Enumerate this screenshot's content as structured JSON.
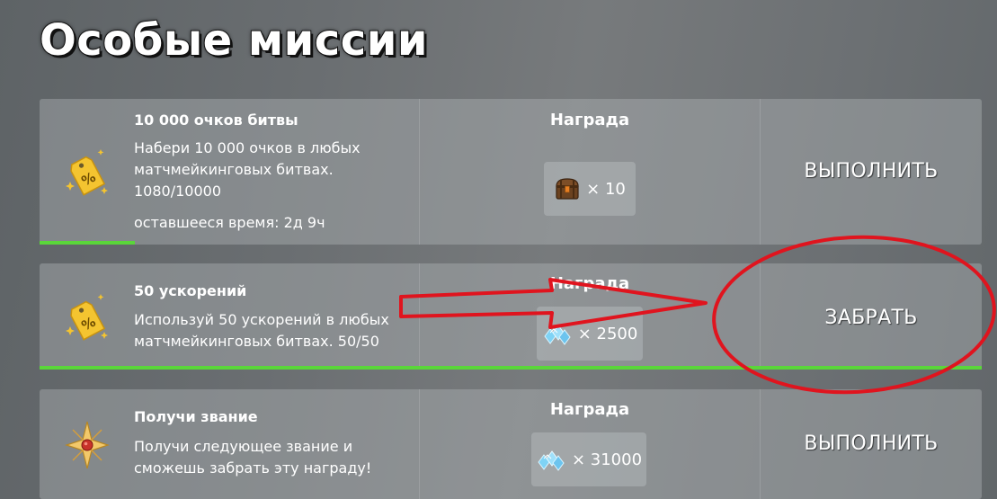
{
  "page": {
    "title": "Особые миссии"
  },
  "missions": [
    {
      "title": "10 000 очков битвы",
      "description": "Набери 10 000 очков в любых матчмейкинговых битвах. 1080/10000",
      "time_left": "оставшееся время: 2д 9ч",
      "progress": 0.108,
      "reward_title": "Награда",
      "reward_icon": "treasure-chest-icon",
      "reward_amount": "× 10",
      "action": "ВЫПОЛНИТЬ",
      "icon": "percent-tag-icon"
    },
    {
      "title": "50 ускорений",
      "description": "Используй 50 ускорений в любых матчмейкинговых битвах. 50/50",
      "progress": 1.0,
      "reward_title": "Награда",
      "reward_icon": "crystals-icon",
      "reward_amount": "× 2500",
      "action": "ЗАБРАТЬ",
      "icon": "percent-tag-icon"
    },
    {
      "title": "Получи звание",
      "description": "Получи следующее звание и сможешь забрать эту награду!",
      "reward_title": "Награда",
      "reward_icon": "crystals-icon",
      "reward_amount": "× 31000",
      "action": "ВЫПОЛНИТЬ",
      "icon": "rank-star-icon"
    }
  ],
  "colors": {
    "progress": "#5ad63a",
    "annotation": "#e0141e",
    "tag": "#f4c430"
  }
}
